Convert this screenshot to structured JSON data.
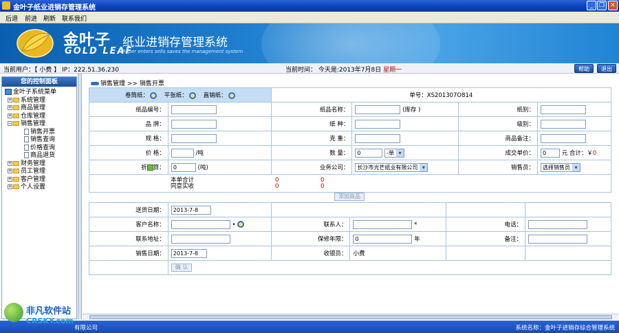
{
  "window": {
    "title": "金叶子纸业进销存管理系统",
    "controls": [
      "_",
      "❐",
      "✕"
    ]
  },
  "menu": [
    "后退",
    "前进",
    "刷新",
    "联系我们"
  ],
  "banner": {
    "brand_cn": "金叶子",
    "brand_en": "GOLD LEAF",
    "system_title": "纸业进销存管理系统",
    "subtitle": "Paper enters sells saves the management system"
  },
  "status": {
    "current_user": "当前用户：【 小费 】 IP：222.51.36.230",
    "current_time_prefix": "当前时间：  今天是:2013年7月8日",
    "weekday": "星期一",
    "help_label": "帮助",
    "logout_label": "退出"
  },
  "sidebar": {
    "header": "您的控制面板",
    "root": "金叶子系统菜单",
    "groups": [
      {
        "label": "系统管理",
        "expanded": false
      },
      {
        "label": "商品管理",
        "expanded": false
      },
      {
        "label": "仓库管理",
        "expanded": false
      },
      {
        "label": "销售管理",
        "expanded": true,
        "children": [
          "销售开票",
          "销售查询",
          "价格查询",
          "商品退货"
        ]
      },
      {
        "label": "财务管理",
        "expanded": false
      },
      {
        "label": "员工管理",
        "expanded": false
      },
      {
        "label": "客户管理",
        "expanded": false
      },
      {
        "label": "个人设置",
        "expanded": false
      }
    ]
  },
  "breadcrumb": {
    "section": "销售管理",
    "sep": ">>",
    "page": "销售开票"
  },
  "form_top": {
    "search_roll": "卷筒纸：",
    "search_flat": "平张纸：",
    "search_direct": "直销纸：",
    "order_no": "单号：XS201307O814",
    "labels": {
      "paper_code": "纸品编号：",
      "paper_name": "纸品名称：",
      "stock": "(库存 )",
      "grade": "纸别：",
      "brand": "品    牌：",
      "paper_type": "纸    种：",
      "level": "级别：",
      "spec": "规    格：",
      "weight": "克    重：",
      "goods_remark": "商品备注：",
      "price": "价    格：",
      "per_ton": "/吨",
      "qty": "数    量：",
      "deal_price": "成交单价：",
      "yuan": "元",
      "total": "合计：￥",
      "discount_a": "折",
      "discount_b": "算：",
      "ton": "(吨)",
      "company": "业务公司：",
      "salesman": "销售员："
    },
    "values": {
      "qty": "0",
      "unit": "-单",
      "deal_price": "0",
      "total": "0",
      "discount": "0",
      "company": "长沙市光芒纸业有限公司",
      "salesman": "选择销售员"
    },
    "summary": {
      "line1": "本单合计",
      "line2": "同意实收",
      "v1a": "0",
      "v1b": "0",
      "v2a": "0",
      "v2b": "0"
    },
    "add_button": "添加商品"
  },
  "form_bottom": {
    "delivery_date_label": "送货日期：",
    "delivery_date": "2013-7-8",
    "customer_label": "客户名称：",
    "contact_label": "联系人：",
    "phone_label": "电话：",
    "address_label": "联系地址：",
    "warranty_label": "保修年限：",
    "warranty_value": "0",
    "year": "年",
    "remark_label": "备注：",
    "sale_date_label": "销售日期：",
    "sale_date": "2013-7-8",
    "cashier_label": "收银员：",
    "cashier": "小费",
    "confirm_button": "确 认"
  },
  "footer": {
    "left": "有限公司",
    "right": "系统名称：金叶子进销存综合管理系统"
  },
  "watermark": {
    "line1": "非凡软件站",
    "line2": "CRSKY.com"
  }
}
